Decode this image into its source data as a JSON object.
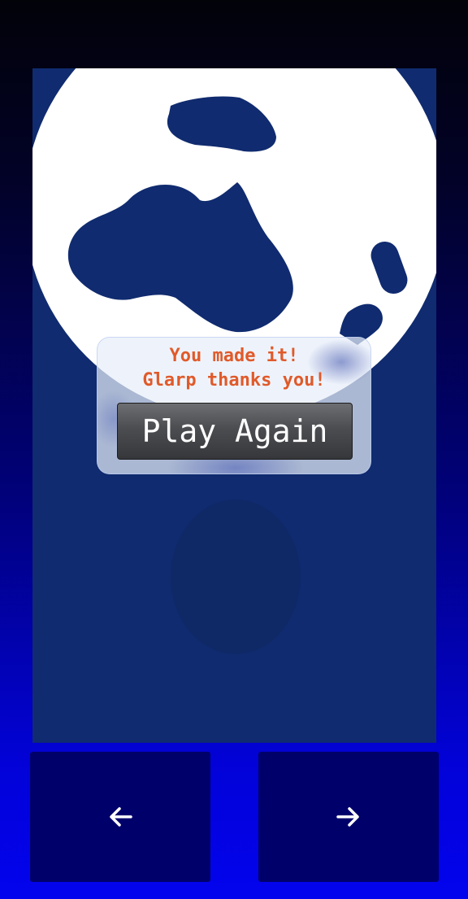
{
  "dialog": {
    "message_line1": "You made it!",
    "message_line2": "Glarp thanks you!",
    "play_again_label": "Play Again"
  },
  "navigation": {
    "left_icon": "arrow-left-icon",
    "right_icon": "arrow-right-icon"
  },
  "colors": {
    "canvas_bg": "#102b6f",
    "planet": "#ffffff",
    "land": "#102b6f",
    "message_text": "#e05a2a",
    "nav_button_bg": "#00006b"
  }
}
